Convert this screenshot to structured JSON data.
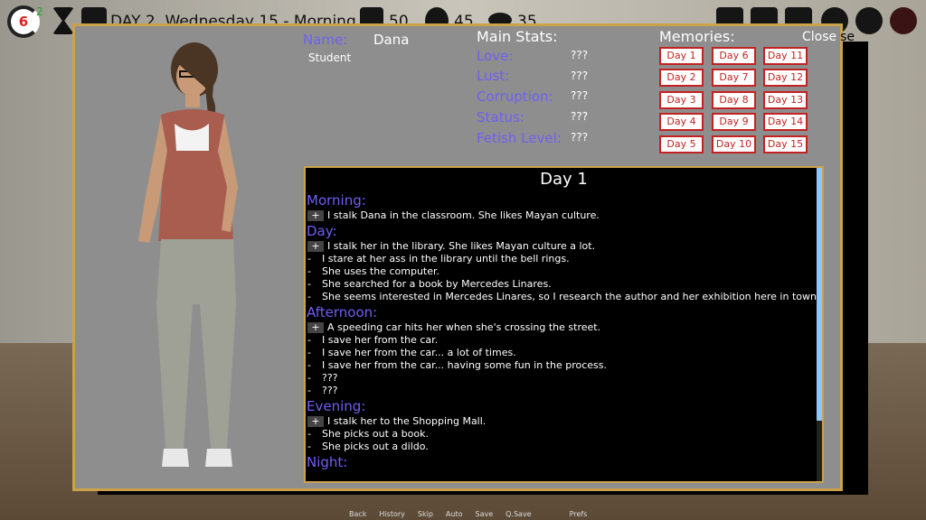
{
  "hud": {
    "counter": "6",
    "counter_sup": "2",
    "date_text": "DAY 2, Wednesday 15 - Morning",
    "stat_a": "50",
    "stat_b": "45",
    "stat_c": "35",
    "icons": [
      "hourglass-icon",
      "calendar-icon",
      "shirt-icon",
      "money-bag-icon",
      "lips-icon",
      "notes-icon",
      "map-icon",
      "bag-icon",
      "chat-icon",
      "profile-icon",
      "demon-mask-icon"
    ]
  },
  "profile": {
    "name_label": "Name:",
    "name": "Dana",
    "occupation": "Student",
    "close_label": "Close",
    "close_shadow": "se"
  },
  "stats": {
    "header": "Main Stats:",
    "items": [
      {
        "label": "Love:",
        "value": "???"
      },
      {
        "label": "Lust:",
        "value": "???"
      },
      {
        "label": "Corruption:",
        "value": "???"
      },
      {
        "label": "Status:",
        "value": "???"
      },
      {
        "label": "Fetish Level:",
        "value": "???"
      }
    ]
  },
  "memories": {
    "header": "Memories:",
    "days": [
      "Day 1",
      "Day 2",
      "Day 3",
      "Day 4",
      "Day 5",
      "Day 6",
      "Day 7",
      "Day 8",
      "Day 9",
      "Day 10",
      "Day 11",
      "Day 12",
      "Day 13",
      "Day 14",
      "Day 15"
    ]
  },
  "log": {
    "title": "Day 1",
    "sections": [
      {
        "name": "Morning:",
        "entries": [
          {
            "plus": true,
            "text": "I stalk Dana in the classroom. She likes Mayan culture."
          }
        ]
      },
      {
        "name": "Day:",
        "entries": [
          {
            "plus": true,
            "text": "I stalk her in the library. She likes Mayan culture a lot."
          },
          {
            "plus": false,
            "text": "I stare at her ass in the library until the bell rings."
          },
          {
            "plus": false,
            "text": "She uses the computer."
          },
          {
            "plus": false,
            "text": "She searched for a book by Mercedes Linares."
          },
          {
            "plus": false,
            "text": "She seems interested in Mercedes Linares, so I research the author and her exhibition here in town."
          }
        ]
      },
      {
        "name": "Afternoon:",
        "entries": [
          {
            "plus": true,
            "text": "A speeding car hits her when she's crossing the street."
          },
          {
            "plus": false,
            "text": "I save her from the car."
          },
          {
            "plus": false,
            "text": "I save her from the car... a lot of times."
          },
          {
            "plus": false,
            "text": "I save her from the car... having some fun in the process."
          },
          {
            "plus": false,
            "text": "???"
          },
          {
            "plus": false,
            "text": "???"
          }
        ]
      },
      {
        "name": "Evening:",
        "entries": [
          {
            "plus": true,
            "text": "I stalk her to the Shopping Mall."
          },
          {
            "plus": false,
            "text": "She picks out a book."
          },
          {
            "plus": false,
            "text": "She picks out a dildo."
          }
        ]
      },
      {
        "name": "Night:",
        "entries": []
      }
    ]
  },
  "quick_menu": [
    "Back",
    "History",
    "Skip",
    "Auto",
    "Save",
    "Q.Save",
    "Prefs"
  ]
}
